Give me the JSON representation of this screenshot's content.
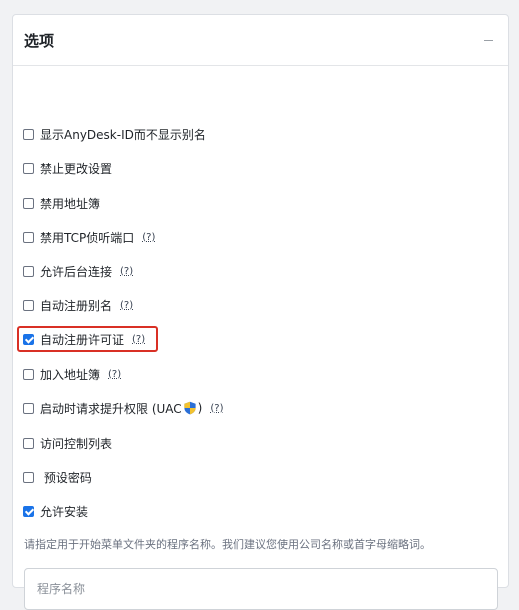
{
  "panel": {
    "title": "选项",
    "collapse_icon": "minus-icon"
  },
  "options": [
    {
      "label": "显示AnyDesk-ID而不显示别名",
      "checked": false,
      "help": ""
    },
    {
      "label": "禁止更改设置",
      "checked": false,
      "help": ""
    },
    {
      "label": "禁用地址簿",
      "checked": false,
      "help": ""
    },
    {
      "label": "禁用TCP侦听端口",
      "checked": false,
      "help": "(?)"
    },
    {
      "label": "允许后台连接",
      "checked": false,
      "help": "(?)"
    },
    {
      "label": "自动注册别名",
      "checked": false,
      "help": "(?)"
    },
    {
      "label": "自动注册许可证",
      "checked": true,
      "help": "(?)",
      "highlighted": true
    },
    {
      "label": "加入地址簿",
      "checked": false,
      "help": "(?)"
    },
    {
      "label": "启动时请求提升权限 (UAC",
      "label_suffix": ")",
      "checked": false,
      "help": "(?)",
      "icon": "uac-shield-icon"
    },
    {
      "label": "访问控制列表",
      "checked": false,
      "help": ""
    },
    {
      "label": " 预设密码",
      "checked": false,
      "help": ""
    },
    {
      "label": "允许安装",
      "checked": true,
      "help": ""
    }
  ],
  "hint": "请指定用于开始菜单文件夹的程序名称。我们建议您使用公司名称或首字母缩略词。",
  "program_name": {
    "value": "",
    "placeholder": "程序名称"
  },
  "colors": {
    "accent": "#1a73e8",
    "highlight": "#d93025"
  }
}
